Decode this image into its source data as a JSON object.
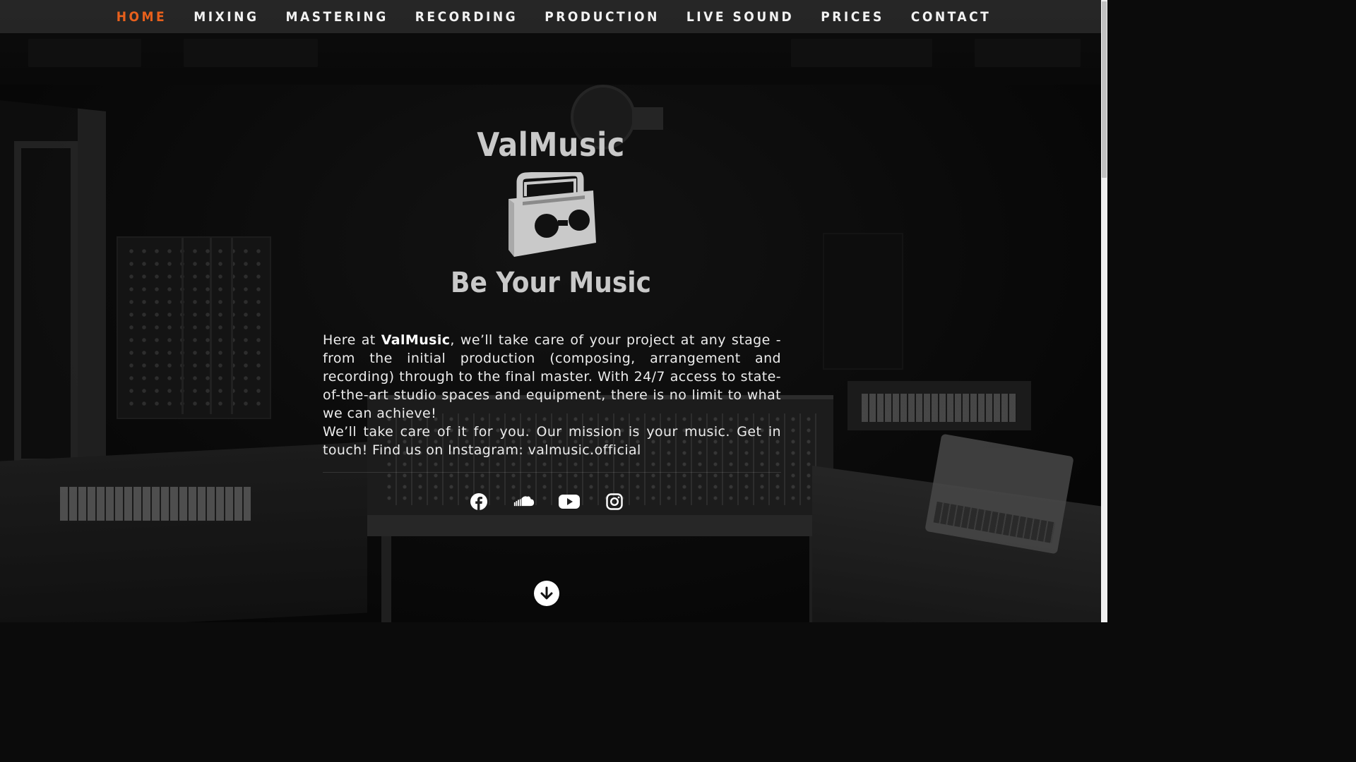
{
  "nav": {
    "items": [
      {
        "label": "HOME",
        "active": true
      },
      {
        "label": "MIXING"
      },
      {
        "label": "MASTERING"
      },
      {
        "label": "RECORDING"
      },
      {
        "label": "PRODUCTION"
      },
      {
        "label": "LIVE SOUND"
      },
      {
        "label": "PRICES"
      },
      {
        "label": "CONTACT"
      }
    ],
    "active_color": "#e8601c"
  },
  "hero": {
    "brand": "ValMusic",
    "logo_icon": "boombox-icon",
    "tagline": "Be Your Music",
    "intro": {
      "p1_before": "Here at ",
      "p1_brand": "ValMusic",
      "p1_after": ", we’ll take care of your project at any stage - from the initial production (composing, arrangement and recording) through to the final master. With 24/7 access to state-of-the-art studio spaces and equipment, there is no limit to what we can achieve!",
      "p2": "We’ll take care of it for you. Our mission is your music. Get in touch! Find us on Instagram: valmusic.official"
    },
    "socials": [
      "facebook-icon",
      "soundcloud-icon",
      "youtube-icon",
      "instagram-icon"
    ],
    "scroll_icon": "arrow-down-circle-icon"
  },
  "colors": {
    "text": "#ececec",
    "brand_gray": "#c9c9c9",
    "nav_bg": "#282828"
  }
}
